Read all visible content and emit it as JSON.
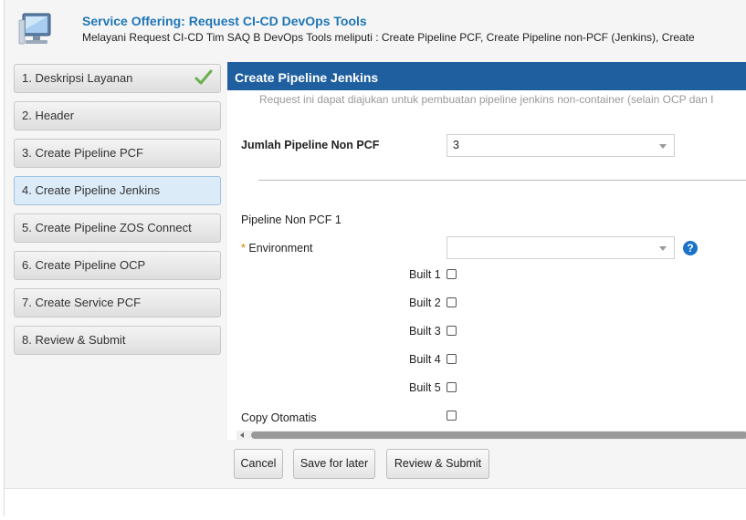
{
  "header": {
    "title": "Service Offering: Request CI-CD DevOps Tools",
    "subtitle": "Melayani Request CI-CD Tim SAQ B DevOps Tools meliputi : Create Pipeline PCF, Create Pipeline non-PCF (Jenkins), Create",
    "logo_icon": "computer-monitor-icon"
  },
  "sidebar": {
    "items": [
      {
        "label": "1. Deskripsi Layanan",
        "completed": true
      },
      {
        "label": "2. Header"
      },
      {
        "label": "3. Create Pipeline PCF"
      },
      {
        "label": "4. Create Pipeline Jenkins",
        "active": true
      },
      {
        "label": "5. Create Pipeline ZOS Connect"
      },
      {
        "label": "6. Create Pipeline OCP"
      },
      {
        "label": "7. Create Service PCF"
      },
      {
        "label": "8. Review & Submit"
      }
    ],
    "check_icon": "checkmark-icon",
    "check_color": "#6ab04c"
  },
  "panel": {
    "title": "Create Pipeline Jenkins",
    "note": "Request ini dapat diajukan untuk pembuatan pipeline jenkins non-container (selain OCP dan I",
    "jumlah_label": "Jumlah Pipeline Non PCF",
    "jumlah_value": "3",
    "section_title": "Pipeline Non PCF 1",
    "environment_label": "Environment",
    "environment_required": "*",
    "environment_value": "",
    "help_glyph": "?",
    "built_labels": [
      "Built 1",
      "Built 2",
      "Built 3",
      "Built 4",
      "Built 5"
    ],
    "copy_label": "Copy Otomatis",
    "header_color": "#1f5f9f"
  },
  "buttons": {
    "cancel": "Cancel",
    "save": "Save for later",
    "review": "Review & Submit"
  }
}
